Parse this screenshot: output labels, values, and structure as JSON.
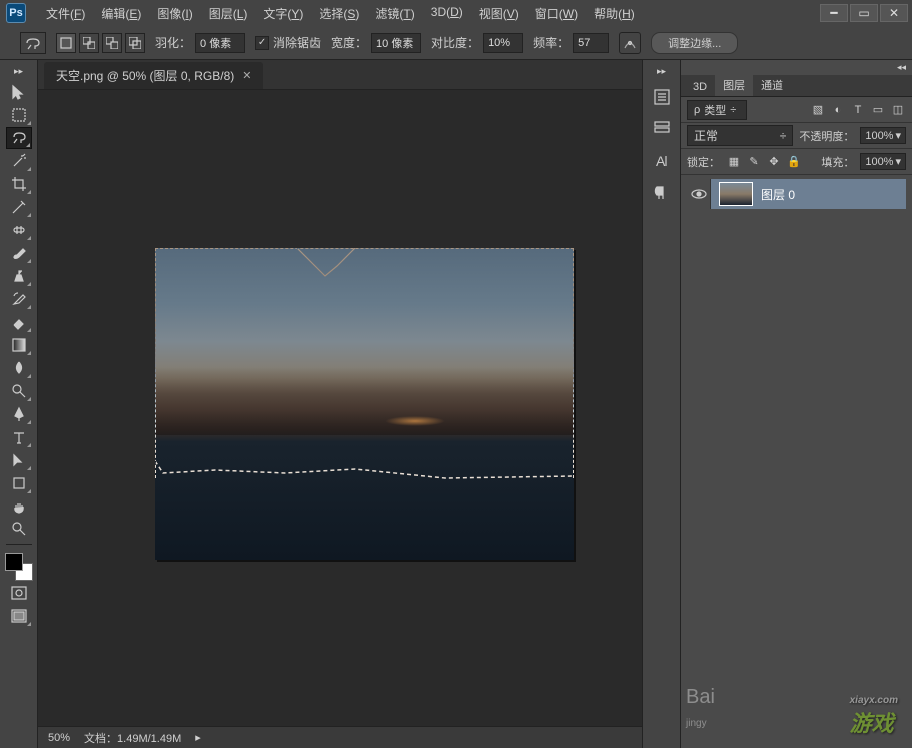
{
  "menubar": [
    {
      "label": "文件",
      "hotkey": "F"
    },
    {
      "label": "编辑",
      "hotkey": "E"
    },
    {
      "label": "图像",
      "hotkey": "I"
    },
    {
      "label": "图层",
      "hotkey": "L"
    },
    {
      "label": "文字",
      "hotkey": "Y"
    },
    {
      "label": "选择",
      "hotkey": "S"
    },
    {
      "label": "滤镜",
      "hotkey": "T"
    },
    {
      "label": "3D",
      "hotkey": "D"
    },
    {
      "label": "视图",
      "hotkey": "V"
    },
    {
      "label": "窗口",
      "hotkey": "W"
    },
    {
      "label": "帮助",
      "hotkey": "H"
    }
  ],
  "options": {
    "feather_label": "羽化：",
    "feather_value": "0 像素",
    "antialias_label": "消除锯齿",
    "antialias_checked": true,
    "width_label": "宽度：",
    "width_value": "10 像素",
    "contrast_label": "对比度：",
    "contrast_value": "10%",
    "frequency_label": "频率：",
    "frequency_value": "57",
    "refine_edge": "调整边缘..."
  },
  "document": {
    "tab_title": "天空.png @ 50% (图层 0, RGB/8)"
  },
  "status": {
    "zoom": "50%",
    "docinfo_label": "文档：",
    "docinfo_value": "1.49M/1.49M"
  },
  "panels": {
    "tabs": {
      "t3d": "3D",
      "layers": "图层",
      "channels": "通道"
    },
    "kind_label": "类型",
    "blend_mode": "正常",
    "opacity_label": "不透明度：",
    "opacity_value": "100%",
    "lock_label": "锁定：",
    "fill_label": "填充：",
    "fill_value": "100%",
    "layer_name": "图层 0"
  },
  "watermark": {
    "site": "xiayx.com",
    "brand": "游戏",
    "baidu": "Bai",
    "jingyan": "jingy"
  }
}
